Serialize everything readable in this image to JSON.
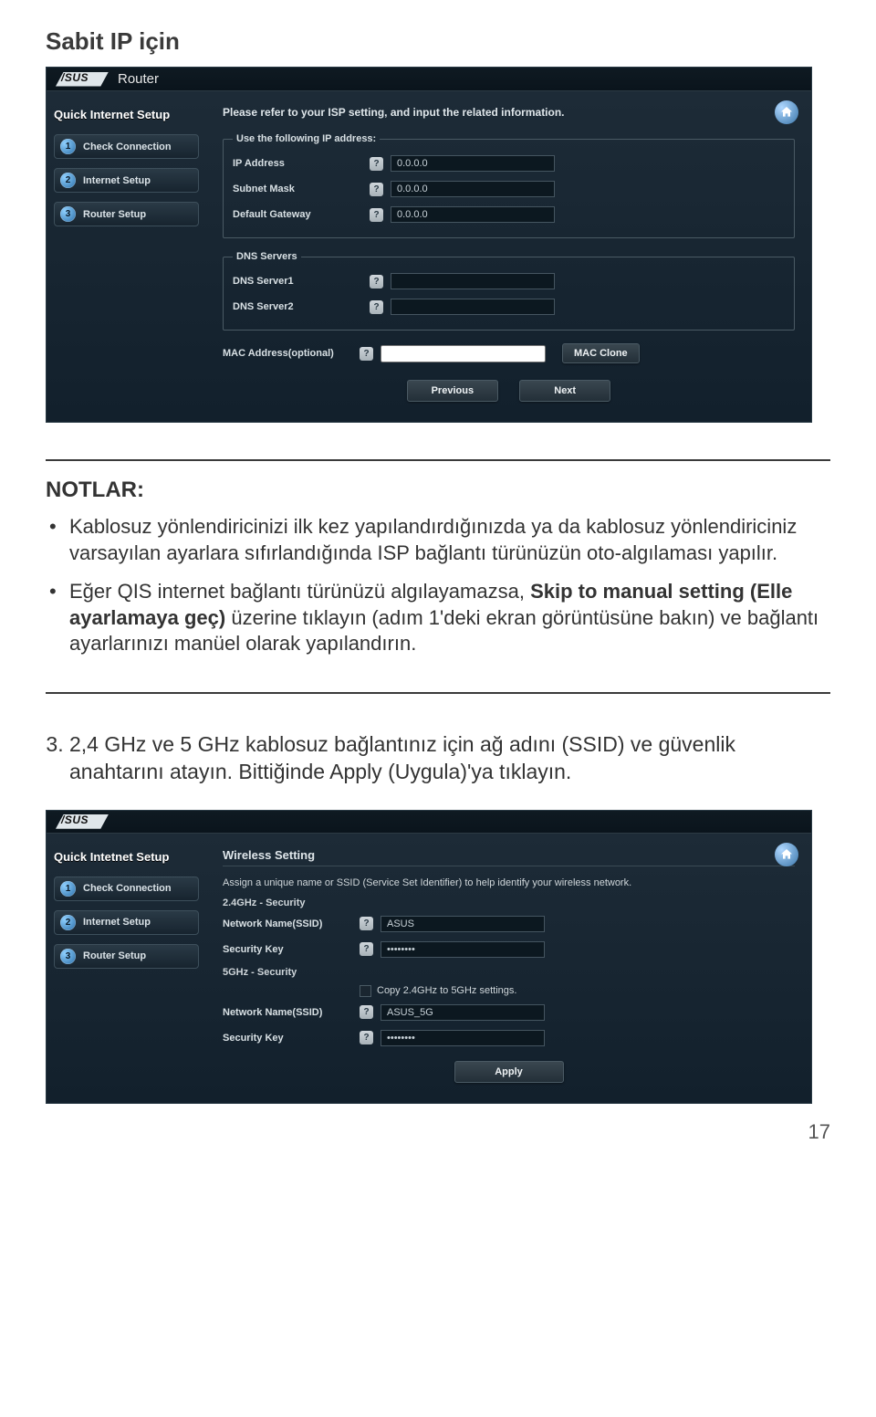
{
  "page_number": "17",
  "section_title": "Sabit IP için",
  "screenshot1": {
    "brand": "/SUS",
    "product": "Router",
    "home_icon": "home-icon",
    "sidebar": {
      "heading": "Quick Internet Setup",
      "steps": [
        {
          "num": "1",
          "label": "Check Connection"
        },
        {
          "num": "2",
          "label": "Internet Setup"
        },
        {
          "num": "3",
          "label": "Router Setup"
        }
      ]
    },
    "instruction": "Please refer to your ISP setting, and input the related information.",
    "fieldset1": {
      "legend": "Use the following IP address:",
      "rows": [
        {
          "label": "IP Address",
          "value": "0.0.0.0"
        },
        {
          "label": "Subnet Mask",
          "value": "0.0.0.0"
        },
        {
          "label": "Default Gateway",
          "value": "0.0.0.0"
        }
      ]
    },
    "fieldset2": {
      "legend": "DNS Servers",
      "rows": [
        {
          "label": "DNS Server1",
          "value": ""
        },
        {
          "label": "DNS Server2",
          "value": ""
        }
      ]
    },
    "mac": {
      "label": "MAC Address(optional)",
      "value": "",
      "clone_button": "MAC Clone"
    },
    "prev": "Previous",
    "next": "Next"
  },
  "notes": {
    "heading": "NOTLAR:",
    "items": [
      "Kablosuz yönlendiricinizi ilk kez yapılandırdığınızda ya da kablosuz yönlendiriciniz varsayılan ayarlara sıfırlandığında ISP bağlantı türünüzün oto-algılaması yapılır.",
      "Eğer QIS internet bağlantı türünüzü algılayamazsa, Skip to manual setting (Elle ayarlamaya geç) üzerine tıklayın (adım 1'deki ekran görüntüsüne bakın) ve bağlantı ayarlarınızı manüel olarak yapılandırın."
    ],
    "bold_phrase": "Skip to manual setting (Elle ayarlamaya geç)"
  },
  "step3_text": "2,4 GHz ve 5 GHz kablosuz bağlantınız için ağ adını (SSID) ve güvenlik anahtarını atayın. Bittiğinde Apply (Uygula)'ya tıklayın.",
  "screenshot2": {
    "brand": "/SUS",
    "product": "",
    "sidebar": {
      "heading": "Quick Intetnet Setup",
      "steps": [
        {
          "num": "1",
          "label": "Check Connection"
        },
        {
          "num": "2",
          "label": "Internet Setup"
        },
        {
          "num": "3",
          "label": "Router Setup"
        }
      ]
    },
    "panel_title": "Wireless Setting",
    "instruction": "Assign a unique name or SSID (Service Set Identifier) to help identify your wireless network.",
    "section24": {
      "heading": "2.4GHz - Security",
      "ssid_label": "Network Name(SSID)",
      "ssid_value": "ASUS",
      "key_label": "Security Key",
      "key_value": "••••••••"
    },
    "copy_label": "Copy 2.4GHz to 5GHz settings.",
    "section5": {
      "heading": "5GHz - Security",
      "ssid_label": "Network Name(SSID)",
      "ssid_value": "ASUS_5G",
      "key_label": "Security Key",
      "key_value": "••••••••"
    },
    "apply": "Apply"
  }
}
